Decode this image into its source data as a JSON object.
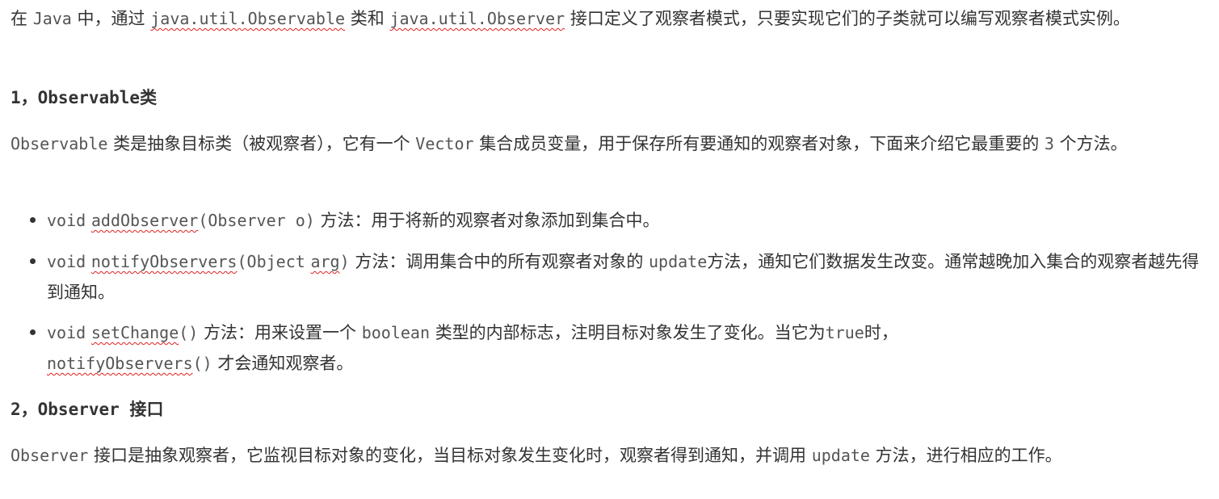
{
  "intro": {
    "t1": "在",
    "java": "Java",
    "t2": "中，通过",
    "observable_fq": "java.util.Observable",
    "t3": "类和",
    "observer_fq": "java.util.Observer",
    "t4": "接口定义了观察者模式，只要实现它们的子类就可以编写观察者模式实例。"
  },
  "section1": {
    "heading_num": "1，Observable",
    "heading_cjk": "类",
    "p_code1": "Observable",
    "p_t1": "类是抽象目标类（被观察者），它有一个",
    "p_code2": "Vector",
    "p_t2": "集合成员变量，用于保存所有要通知的观察者对象，下面来介绍它最重要的",
    "p_code3": "3",
    "p_t3": "个方法。"
  },
  "methods": [
    {
      "void": "void",
      "name": "addObserver",
      "args": "(Observer o)",
      "desc": "方法：用于将新的观察者对象添加到集合中。"
    },
    {
      "void": "void",
      "name": "notifyObservers",
      "args_open": "(Object",
      "arg": "arg",
      "args_close": ")",
      "desc1": "方法：调用集合中的所有观察者对象的",
      "update": "update",
      "desc2": "方法，通知它们数据发生改变。通常越晚加入集合的观察者越先得到通知。"
    },
    {
      "void": "void",
      "name": "setChange",
      "args": "()",
      "desc1": "方法：用来设置一个",
      "boolean": "boolean",
      "desc2": "类型的内部标志，注明目标对象发生了变化。当它为",
      "true_kw": "true",
      "desc3": "时，",
      "notify": "notifyObservers",
      "notify_args": "()",
      "desc4": "才会通知观察者。"
    }
  ],
  "section2": {
    "heading_num": "2，Observer",
    "heading_cjk": "接口",
    "p_code1": "Observer",
    "p_t1": "接口是抽象观察者，它监视目标对象的变化，当目标对象发生变化时，观察者得到通知，并调用",
    "p_code2": "update",
    "p_t2": "方法，进行相应的工作。"
  },
  "colors": {
    "text": "#333333",
    "code": "#555555",
    "spellcheck": "#e02020"
  }
}
